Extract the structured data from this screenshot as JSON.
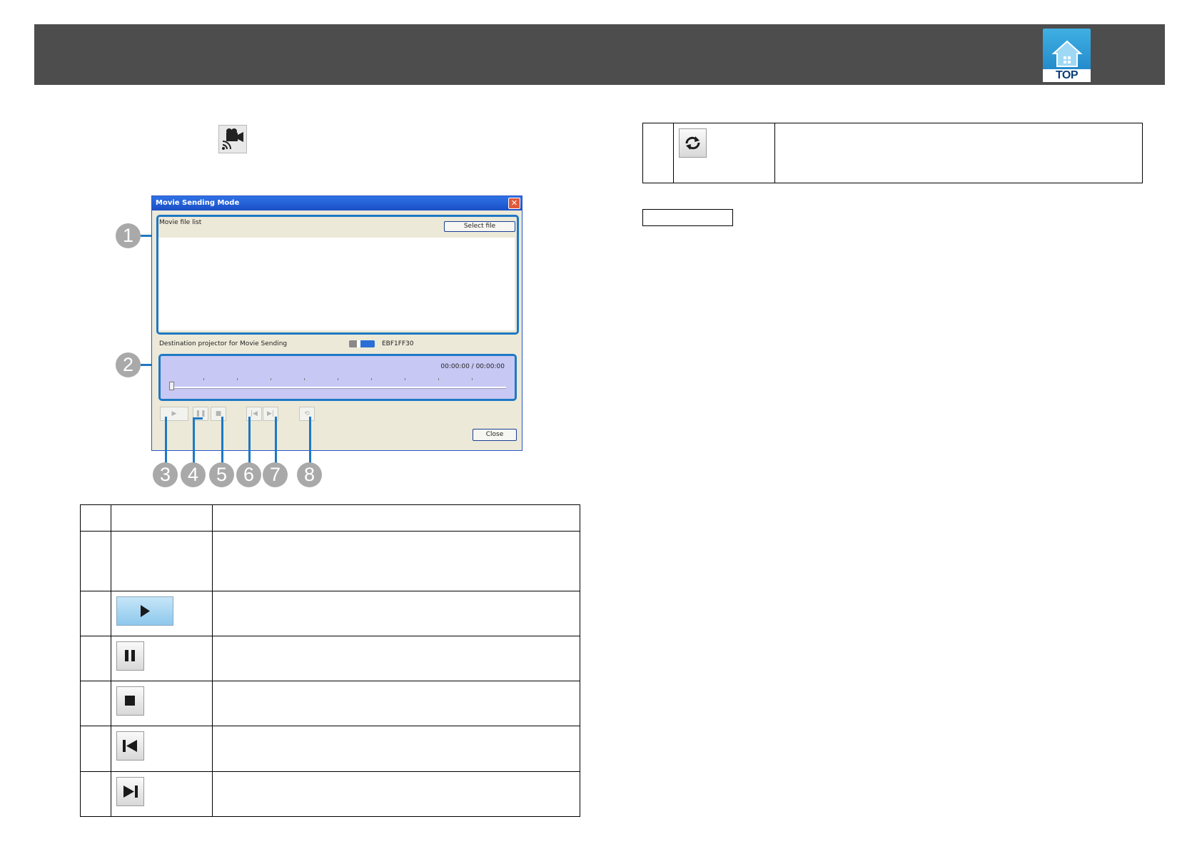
{
  "header": {
    "top_badge_label": "TOP",
    "colors": {
      "bar": "#4d4d4d",
      "badge": "#2a90d4"
    }
  },
  "toolbar_icon": {
    "icon": "movie-camera-icon"
  },
  "window": {
    "title": "Movie Sending Mode",
    "close_glyph": "✕",
    "file_list_label": "Movie file list",
    "select_file_label": "Select file",
    "destination_label": "Destination projector for Movie Sending",
    "destination_value": "EBF1FF30",
    "time_display": "00:00:00 / 00:00:00",
    "close_button_label": "Close",
    "controls": [
      {
        "name": "play",
        "glyph": "▶"
      },
      {
        "name": "pause",
        "glyph": "❚❚"
      },
      {
        "name": "stop",
        "glyph": "■"
      },
      {
        "name": "previous",
        "glyph": "|◀"
      },
      {
        "name": "next",
        "glyph": "▶|"
      },
      {
        "name": "repeat",
        "glyph": "⟲"
      }
    ]
  },
  "callouts": [
    "1",
    "2",
    "3",
    "4",
    "5",
    "6",
    "7",
    "8"
  ],
  "accent_color": "#1e78c4",
  "main_table": {
    "rows": [
      {
        "icon": "none"
      },
      {
        "icon": "play-icon"
      },
      {
        "icon": "pause-icon"
      },
      {
        "icon": "stop-icon"
      },
      {
        "icon": "previous-track-icon"
      },
      {
        "icon": "next-track-icon"
      }
    ]
  },
  "right_table": {
    "rows": [
      {
        "icon": "repeat-icon"
      }
    ]
  }
}
